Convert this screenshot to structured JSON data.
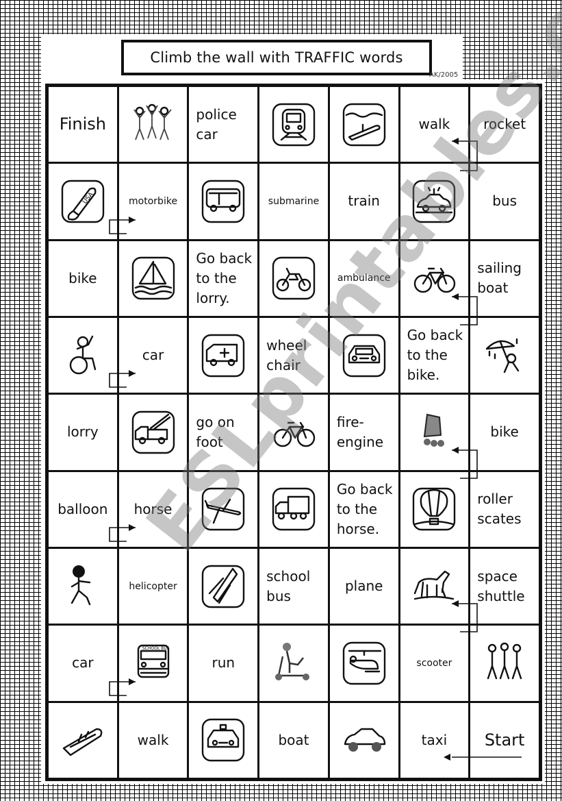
{
  "title": "Climb the wall with TRAFFIC words",
  "credit": "AK/2005",
  "watermark": "ESLprintables.com",
  "board": {
    "rows": [
      [
        {
          "type": "text",
          "text": "Finish",
          "size": "big"
        },
        {
          "type": "picture",
          "icon": "children-celebrating-icon"
        },
        {
          "type": "text",
          "text": "police car",
          "align": "left",
          "size": "med"
        },
        {
          "type": "picture",
          "icon": "train-icon"
        },
        {
          "type": "picture",
          "icon": "submarine-icon"
        },
        {
          "type": "text",
          "text": "walk",
          "size": "med"
        },
        {
          "type": "text",
          "text": "rocket",
          "size": "med"
        }
      ],
      [
        {
          "type": "picture",
          "icon": "rocket-icon"
        },
        {
          "type": "text",
          "text": "motorbike",
          "size": "small"
        },
        {
          "type": "picture",
          "icon": "bus-icon"
        },
        {
          "type": "text",
          "text": "submarine",
          "size": "small"
        },
        {
          "type": "text",
          "text": "train",
          "size": "med"
        },
        {
          "type": "picture",
          "icon": "police-car-icon"
        },
        {
          "type": "text",
          "text": "bus",
          "size": "med"
        }
      ],
      [
        {
          "type": "text",
          "text": "bike",
          "size": "med"
        },
        {
          "type": "picture",
          "icon": "sailing-boat-icon"
        },
        {
          "type": "text",
          "text": "Go back to the lorry.",
          "align": "left",
          "size": "med"
        },
        {
          "type": "picture",
          "icon": "motorbike-icon"
        },
        {
          "type": "text",
          "text": "ambulance",
          "size": "small"
        },
        {
          "type": "picture",
          "icon": "bicycle-icon"
        },
        {
          "type": "text",
          "text": "sailing boat",
          "align": "left",
          "size": "med"
        }
      ],
      [
        {
          "type": "picture",
          "icon": "wheelchair-icon"
        },
        {
          "type": "text",
          "text": "car",
          "size": "med"
        },
        {
          "type": "picture",
          "icon": "ambulance-icon"
        },
        {
          "type": "text",
          "text": "wheel chair",
          "align": "left",
          "size": "med"
        },
        {
          "type": "picture",
          "icon": "car-icon"
        },
        {
          "type": "text",
          "text": "Go back to the bike.",
          "align": "left",
          "size": "med"
        },
        {
          "type": "picture",
          "icon": "umbrella-rain-icon"
        }
      ],
      [
        {
          "type": "text",
          "text": "lorry",
          "size": "med"
        },
        {
          "type": "picture",
          "icon": "fire-engine-icon"
        },
        {
          "type": "text",
          "text": "go on foot",
          "align": "left",
          "size": "med"
        },
        {
          "type": "picture",
          "icon": "bicycle-icon"
        },
        {
          "type": "text",
          "text": "fire-engine",
          "align": "left",
          "size": "med"
        },
        {
          "type": "picture",
          "icon": "roller-skates-icon"
        },
        {
          "type": "text",
          "text": "bike",
          "size": "med"
        }
      ],
      [
        {
          "type": "text",
          "text": "balloon",
          "size": "med"
        },
        {
          "type": "text",
          "text": "horse",
          "size": "med"
        },
        {
          "type": "picture",
          "icon": "plane-icon"
        },
        {
          "type": "picture",
          "icon": "lorry-icon"
        },
        {
          "type": "text",
          "text": "Go back to the horse.",
          "align": "left",
          "size": "med"
        },
        {
          "type": "picture",
          "icon": "hot-air-balloon-icon"
        },
        {
          "type": "text",
          "text": "roller scates",
          "align": "left",
          "size": "med"
        }
      ],
      [
        {
          "type": "picture",
          "icon": "running-child-icon"
        },
        {
          "type": "text",
          "text": "helicopter",
          "size": "small"
        },
        {
          "type": "picture",
          "icon": "space-shuttle-icon"
        },
        {
          "type": "text",
          "text": "school bus",
          "align": "left",
          "size": "med"
        },
        {
          "type": "text",
          "text": "plane",
          "size": "med"
        },
        {
          "type": "picture",
          "icon": "horse-icon"
        },
        {
          "type": "text",
          "text": "space shuttle",
          "align": "left",
          "size": "med"
        }
      ],
      [
        {
          "type": "text",
          "text": "car",
          "size": "med"
        },
        {
          "type": "picture",
          "icon": "school-bus-icon"
        },
        {
          "type": "text",
          "text": "run",
          "size": "med"
        },
        {
          "type": "picture",
          "icon": "scooter-rider-icon"
        },
        {
          "type": "picture",
          "icon": "helicopter-icon"
        },
        {
          "type": "text",
          "text": "scooter",
          "size": "small"
        },
        {
          "type": "picture",
          "icon": "people-walking-icon"
        }
      ],
      [
        {
          "type": "picture",
          "icon": "motorboat-icon"
        },
        {
          "type": "text",
          "text": "walk",
          "size": "med"
        },
        {
          "type": "picture",
          "icon": "taxi-icon"
        },
        {
          "type": "text",
          "text": "boat",
          "size": "med"
        },
        {
          "type": "picture",
          "icon": "sports-car-icon"
        },
        {
          "type": "text",
          "text": "taxi",
          "size": "med"
        },
        {
          "type": "text",
          "text": "Start",
          "size": "big"
        }
      ]
    ]
  }
}
